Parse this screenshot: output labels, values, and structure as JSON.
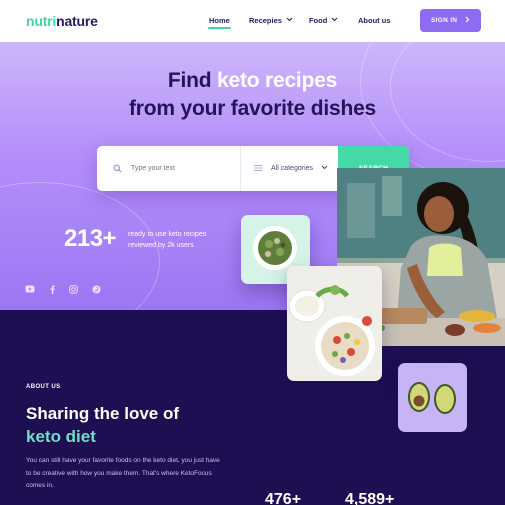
{
  "header": {
    "logo_part1": "nutri",
    "logo_part2": "nature",
    "nav": [
      {
        "label": "Home"
      },
      {
        "label": "Recepies"
      },
      {
        "label": "Food"
      },
      {
        "label": "About us"
      }
    ],
    "signin_label": "SIGN IN"
  },
  "hero": {
    "title_line1_pre": "Find ",
    "title_line1_highlight": "keto recipes",
    "title_line2": "from your favorite dishes",
    "search": {
      "placeholder": "Type your text",
      "category_label": "All categories",
      "button_label": "SEARCH"
    },
    "stat": {
      "number": "213",
      "plus": "+",
      "line1": "ready to use keto recipes",
      "line2": "reviewed by 2k users"
    },
    "social_icons": [
      "youtube-icon",
      "facebook-icon",
      "instagram-icon",
      "pinterest-icon"
    ]
  },
  "about": {
    "label": "ABOUT US",
    "title_line1": "Sharing the love of",
    "title_line2": "keto diet",
    "body": "You can still have your favorite foods on the keto diet, you just have to be creative with how you make them. That's where KetoFocus comes in.",
    "stats": [
      "476+",
      "4,589+"
    ]
  },
  "colors": {
    "primary": "#8e6bf2",
    "accent": "#3dd9a3",
    "dark": "#1e0f52",
    "text_dark": "#2a1a5e"
  }
}
